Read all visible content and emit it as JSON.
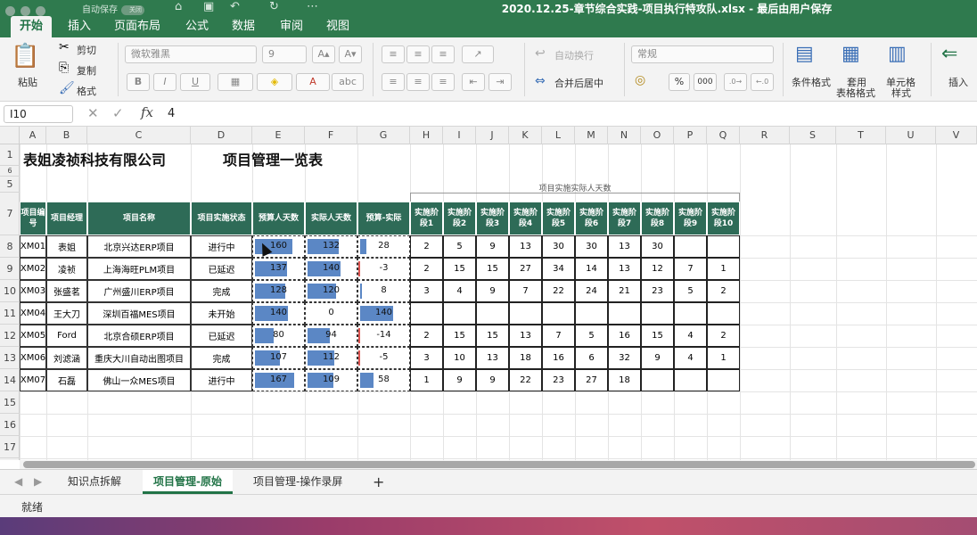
{
  "window": {
    "title": "2020.12.25-章节综合实践-项目执行特攻队.xlsx  -  最后由用户保存",
    "autosave_label": "自动保存",
    "autosave_toggle": "关闭"
  },
  "tabs": [
    "开始",
    "插入",
    "页面布局",
    "公式",
    "数据",
    "审阅",
    "视图"
  ],
  "ribbon": {
    "paste": "粘贴",
    "cut": "剪切",
    "copy": "复制",
    "format": "格式",
    "font_name": "微软雅黑",
    "font_size": "9",
    "bold": "B",
    "italic": "I",
    "underline": "U",
    "wrap": "自动换行",
    "merge": "合并后居中",
    "number_format": "常规",
    "percent": "%",
    "thousands": "000",
    "cond_format": "条件格式",
    "table_style_1": "套用",
    "table_style_2": "表格格式",
    "cell_style_1": "单元格",
    "cell_style_2": "样式",
    "insert": "插入"
  },
  "formula": {
    "namebox": "I10",
    "fx": "fx",
    "value": "4"
  },
  "sheet": {
    "columns": [
      "A",
      "B",
      "C",
      "D",
      "E",
      "F",
      "G",
      "H",
      "I",
      "J",
      "K",
      "L",
      "M",
      "N",
      "O",
      "P",
      "Q",
      "R",
      "S",
      "T",
      "U",
      "V"
    ],
    "rows": [
      "1",
      "6",
      "5",
      "7",
      "8",
      "9",
      "10",
      "11",
      "12",
      "13",
      "14",
      "15",
      "16",
      "17"
    ],
    "title_company": "表姐凌祯科技有限公司",
    "title_sheet": "项目管理一览表",
    "stage_group": "项目实施实际人天数",
    "headers": [
      "项目编号",
      "项目经理",
      "项目名称",
      "项目实施状态",
      "预算人天数",
      "实际人天数",
      "预算-实际",
      "实施阶段1",
      "实施阶段2",
      "实施阶段3",
      "实施阶段4",
      "实施阶段5",
      "实施阶段6",
      "实施阶段7",
      "实施阶段8",
      "实施阶段9",
      "实施阶段10"
    ],
    "rows_data": [
      {
        "id": "XM01",
        "mgr": "表姐",
        "name": "北京兴达ERP项目",
        "status": "进行中",
        "budget": "160",
        "actual": "132",
        "diff": "28",
        "budget_v": 160,
        "actual_v": 132,
        "diff_v": 28,
        "stages": [
          "2",
          "5",
          "9",
          "13",
          "30",
          "30",
          "13",
          "30",
          "",
          ""
        ]
      },
      {
        "id": "XM02",
        "mgr": "凌祯",
        "name": "上海海旺PLM项目",
        "status": "已延迟",
        "budget": "137",
        "actual": "140",
        "diff": "-3",
        "budget_v": 137,
        "actual_v": 140,
        "diff_v": -3,
        "stages": [
          "2",
          "15",
          "15",
          "27",
          "34",
          "14",
          "13",
          "12",
          "7",
          "1"
        ]
      },
      {
        "id": "XM03",
        "mgr": "张盛茗",
        "name": "广州盛川ERP项目",
        "status": "完成",
        "budget": "128",
        "actual": "120",
        "diff": "8",
        "budget_v": 128,
        "actual_v": 120,
        "diff_v": 8,
        "stages": [
          "3",
          "4",
          "9",
          "7",
          "22",
          "24",
          "21",
          "23",
          "5",
          "2"
        ]
      },
      {
        "id": "XM04",
        "mgr": "王大刀",
        "name": "深圳百福MES项目",
        "status": "未开始",
        "budget": "140",
        "actual": "0",
        "diff": "140",
        "budget_v": 140,
        "actual_v": 0,
        "diff_v": 140,
        "stages": [
          "",
          "",
          "",
          "",
          "",
          "",
          "",
          "",
          "",
          ""
        ]
      },
      {
        "id": "XM05",
        "mgr": "Ford",
        "name": "北京合硕ERP项目",
        "status": "已延迟",
        "budget": "80",
        "actual": "94",
        "diff": "-14",
        "budget_v": 80,
        "actual_v": 94,
        "diff_v": -14,
        "stages": [
          "2",
          "15",
          "15",
          "13",
          "7",
          "5",
          "16",
          "15",
          "4",
          "2"
        ]
      },
      {
        "id": "XM06",
        "mgr": "刘滤涵",
        "name": "重庆大川自动出图项目",
        "status": "完成",
        "budget": "107",
        "actual": "112",
        "diff": "-5",
        "budget_v": 107,
        "actual_v": 112,
        "diff_v": -5,
        "stages": [
          "3",
          "10",
          "13",
          "18",
          "16",
          "6",
          "32",
          "9",
          "4",
          "1"
        ]
      },
      {
        "id": "XM07",
        "mgr": "石磊",
        "name": "佛山一众MES项目",
        "status": "进行中",
        "budget": "167",
        "actual": "109",
        "diff": "58",
        "budget_v": 167,
        "actual_v": 109,
        "diff_v": 58,
        "stages": [
          "1",
          "9",
          "9",
          "22",
          "23",
          "27",
          "18",
          "",
          "",
          ""
        ]
      }
    ]
  },
  "sheet_tabs": [
    "知识点拆解",
    "项目管理-原始",
    "项目管理-操作录屏"
  ],
  "sheet_tab_add": "+",
  "status": "就绪",
  "colors": {
    "brand": "#217346",
    "header_fill": "#2e6b57",
    "bar": "#5b87c5",
    "neg_bar": "#d9534f"
  }
}
